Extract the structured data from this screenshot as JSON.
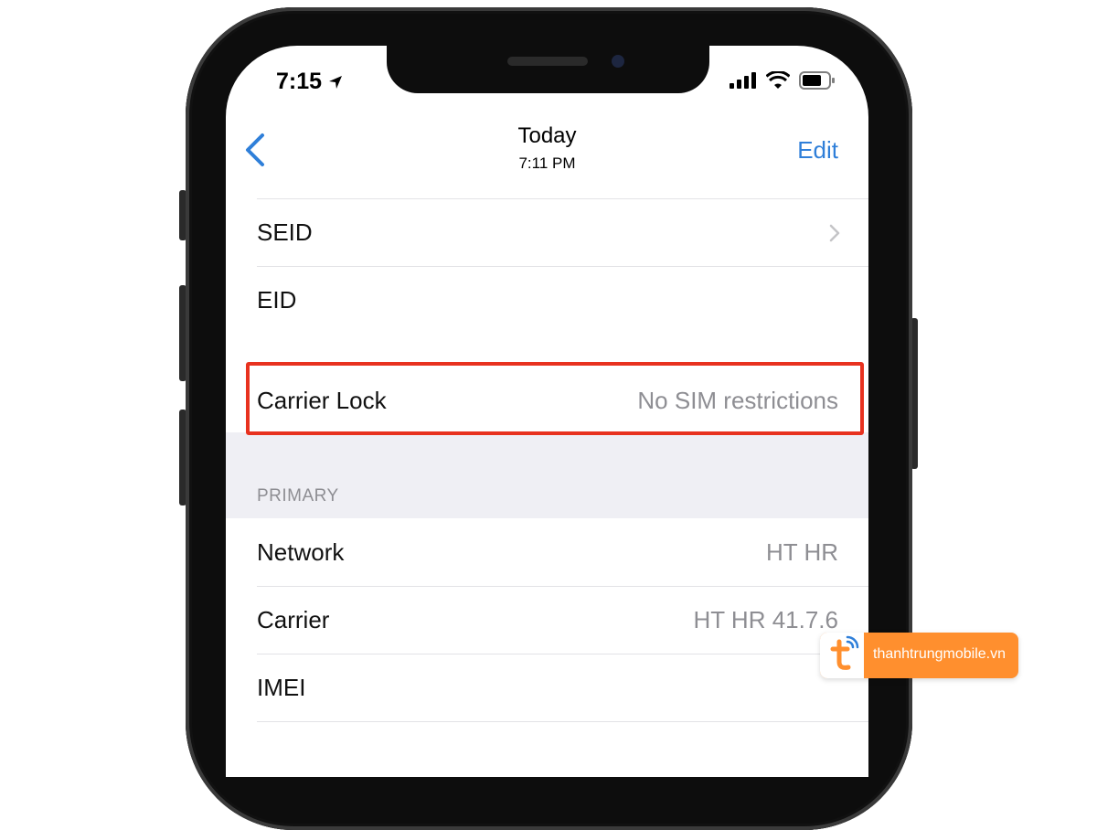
{
  "status_bar": {
    "time": "7:15"
  },
  "nav": {
    "title": "Today",
    "subtitle": "7:11 PM",
    "edit_label": "Edit"
  },
  "rows_top": [
    {
      "label": "SEID",
      "value": ""
    },
    {
      "label": "EID",
      "value": ""
    }
  ],
  "carrier_lock": {
    "label": "Carrier Lock",
    "value": "No SIM restrictions"
  },
  "primary_section": {
    "header": "PRIMARY",
    "rows": [
      {
        "label": "Network",
        "value": "HT HR"
      },
      {
        "label": "Carrier",
        "value": "HT HR 41.7.6"
      },
      {
        "label": "IMEI",
        "value": ""
      }
    ]
  },
  "watermark": {
    "text": "thanhtrungmobile.vn"
  },
  "colors": {
    "accent": "#2f7fd9",
    "highlight": "#e8321f",
    "brand": "#ff8f2e"
  }
}
